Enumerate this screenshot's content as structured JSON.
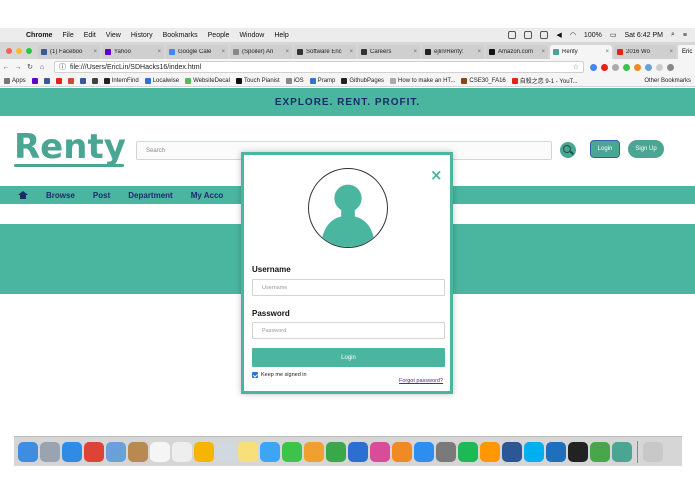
{
  "menubar": {
    "menus": [
      "Chrome",
      "File",
      "Edit",
      "View",
      "History",
      "Bookmarks",
      "People",
      "Window",
      "Help"
    ],
    "battery": "100%",
    "clock": "Sat 6:42 PM"
  },
  "tabs": [
    {
      "label": "(1) Faceboo",
      "color": "#3b5998"
    },
    {
      "label": "Yahoo",
      "color": "#5f01d1"
    },
    {
      "label": "Google Cale",
      "color": "#4285f4"
    },
    {
      "label": "(Spoiler) An",
      "color": "#888888"
    },
    {
      "label": "Software Enc",
      "color": "#333333"
    },
    {
      "label": "Careers",
      "color": "#333333"
    },
    {
      "label": "ejlin/Renty:",
      "color": "#222222"
    },
    {
      "label": "Amazon.com",
      "color": "#111111"
    },
    {
      "label": "Renty",
      "color": "#4aa693",
      "active": true
    },
    {
      "label": "2016 Wo",
      "color": "#e62117"
    }
  ],
  "profile_name": "Eric",
  "address": {
    "url": "file:///Users/EricLin/SDHacks16/index.html"
  },
  "bookmarks": [
    {
      "label": "Apps",
      "color": "#777777"
    },
    {
      "label": "",
      "color": "#5f01d1"
    },
    {
      "label": "",
      "color": "#3b5998"
    },
    {
      "label": "",
      "color": "#e62117"
    },
    {
      "label": "",
      "color": "#d14836"
    },
    {
      "label": "",
      "color": "#3b5998"
    },
    {
      "label": "",
      "color": "#444444"
    },
    {
      "label": "InternFind",
      "color": "#222222"
    },
    {
      "label": "Localwise",
      "color": "#2e72d2"
    },
    {
      "label": "WebsiteDecal",
      "color": "#5cb85c"
    },
    {
      "label": "Touch Pianist",
      "color": "#111111"
    },
    {
      "label": "iOS",
      "color": "#888888"
    },
    {
      "label": "Pramp",
      "color": "#2e72d2"
    },
    {
      "label": "GithubPages",
      "color": "#222222"
    },
    {
      "label": "How to make an HT...",
      "color": "#aaaaaa"
    },
    {
      "label": "CSE30_FA16",
      "color": "#8b4513"
    },
    {
      "label": "自殺之恋 9-1 - YouT...",
      "color": "#e62117"
    }
  ],
  "other_bookmarks": "Other Bookmarks",
  "site": {
    "tagline": "EXPLORE.  RENT.  PROFIT.",
    "logo": "Renty",
    "search_placeholder": "Search",
    "login_label": "Login",
    "signup_label": "Sign Up",
    "nav": [
      "Browse",
      "Post",
      "Department",
      "My Acco"
    ],
    "brand_color": "#4bb6a0"
  },
  "modal": {
    "close": "×",
    "username_label": "Username",
    "username_placeholder": "Username",
    "password_label": "Password",
    "password_placeholder": "Password",
    "login_button": "Login",
    "keep_signed_in": "Keep me signed in",
    "keep_checked": true,
    "forgot": "Forgot password?"
  },
  "dock": [
    {
      "name": "finder-icon",
      "color": "#3f8de0"
    },
    {
      "name": "launchpad-icon",
      "color": "#9aa4b1"
    },
    {
      "name": "safari-icon",
      "color": "#2f8be6"
    },
    {
      "name": "chrome-icon",
      "color": "#db4437"
    },
    {
      "name": "preview-icon",
      "color": "#6aa0d8"
    },
    {
      "name": "contacts-icon",
      "color": "#b88a52"
    },
    {
      "name": "calendar-icon",
      "color": "#f5f5f5"
    },
    {
      "name": "notes-icon",
      "color": "#eeeeee"
    },
    {
      "name": "photos-icon",
      "color": "#f4b400"
    },
    {
      "name": "preview2-icon",
      "color": "#d0d8e0"
    },
    {
      "name": "stickies-icon",
      "color": "#f7e07a"
    },
    {
      "name": "messages-icon",
      "color": "#3ea4f4"
    },
    {
      "name": "facetime-icon",
      "color": "#3cc34a"
    },
    {
      "name": "pages-icon",
      "color": "#f0a030"
    },
    {
      "name": "numbers-icon",
      "color": "#3aa84a"
    },
    {
      "name": "keynote-icon",
      "color": "#2d6fd0"
    },
    {
      "name": "itunes-icon",
      "color": "#d94c9a"
    },
    {
      "name": "ibooks-icon",
      "color": "#f08a24"
    },
    {
      "name": "app-store-icon",
      "color": "#2d8ef0"
    },
    {
      "name": "system-preferences-icon",
      "color": "#7a7a7a"
    },
    {
      "name": "spotify-icon",
      "color": "#1db954"
    },
    {
      "name": "sublime-icon",
      "color": "#ff9800"
    },
    {
      "name": "word-icon",
      "color": "#2b5797"
    },
    {
      "name": "skype-icon",
      "color": "#00aff0"
    },
    {
      "name": "xcode-icon",
      "color": "#1f6fbf"
    },
    {
      "name": "terminal-icon",
      "color": "#222222"
    },
    {
      "name": "vim-icon",
      "color": "#4aa64a"
    },
    {
      "name": "renty-icon",
      "color": "#4aa693"
    },
    {
      "name": "trash-icon",
      "color": "#c8c8c8"
    }
  ]
}
